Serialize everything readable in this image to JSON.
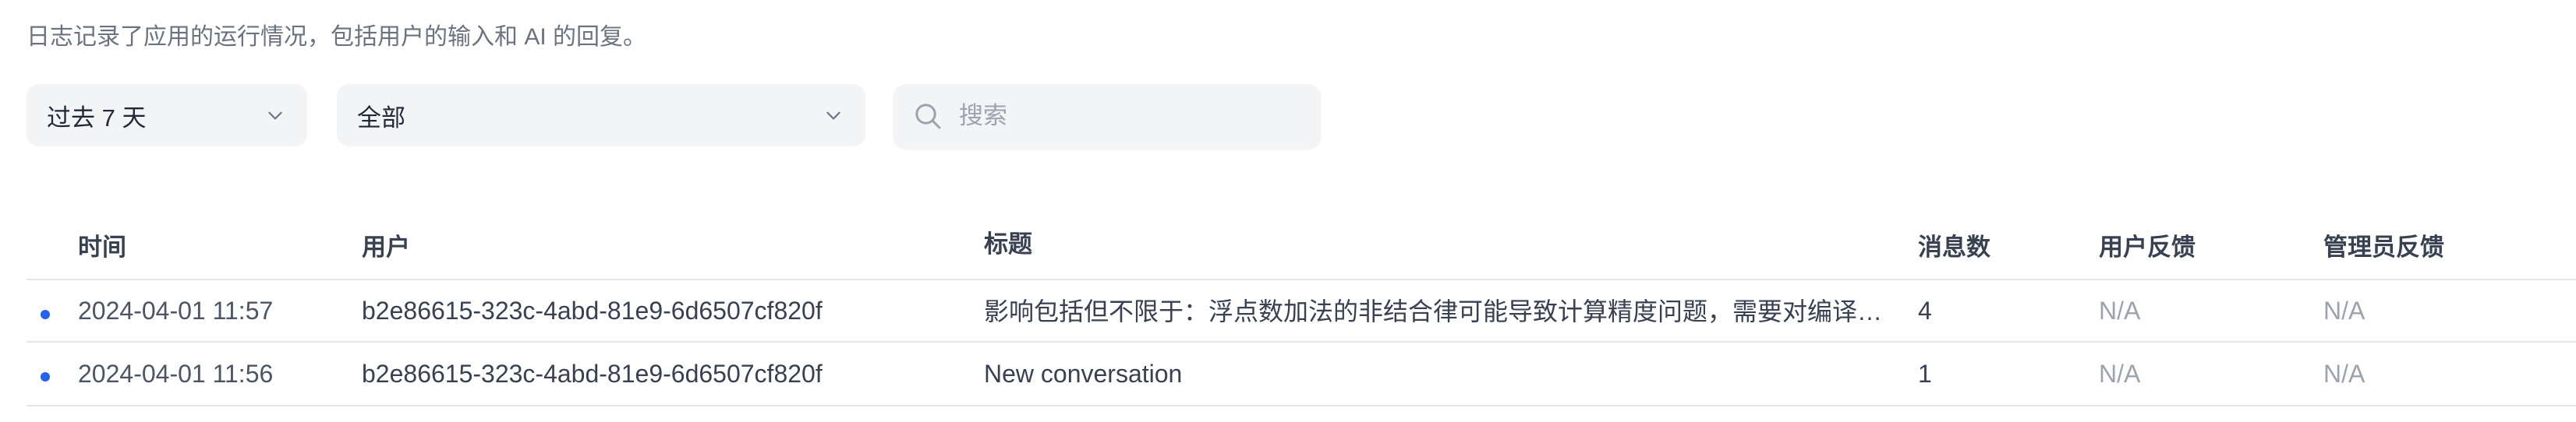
{
  "description": "日志记录了应用的运行情况，包括用户的输入和 AI 的回复。",
  "filters": {
    "period": {
      "value": "过去 7 天",
      "icon": "chevron-down-icon"
    },
    "annotation": {
      "value": "全部",
      "icon": "chevron-down-icon"
    },
    "search": {
      "placeholder": "搜索",
      "value": "",
      "icon": "search-icon"
    }
  },
  "table": {
    "headers": {
      "time": "时间",
      "user": "用户",
      "title": "标题",
      "message_count": "消息数",
      "user_feedback": "用户反馈",
      "admin_feedback": "管理员反馈"
    },
    "rows": [
      {
        "time": "2024-04-01 11:57",
        "user": "b2e86615-323c-4abd-81e9-6d6507cf820f",
        "title": "影响包括但不限于：浮点数加法的非结合律可能导致计算精度问题，需要对编译…",
        "message_count": "4",
        "user_feedback": "N/A",
        "admin_feedback": "N/A"
      },
      {
        "time": "2024-04-01 11:56",
        "user": "b2e86615-323c-4abd-81e9-6d6507cf820f",
        "title": "New conversation",
        "message_count": "1",
        "user_feedback": "N/A",
        "admin_feedback": "N/A"
      }
    ]
  },
  "colors": {
    "unread_dot": "#2563eb",
    "filter_bg": "#f3f4f6",
    "muted_text": "#9ca3af",
    "divider": "#e5e7eb"
  }
}
